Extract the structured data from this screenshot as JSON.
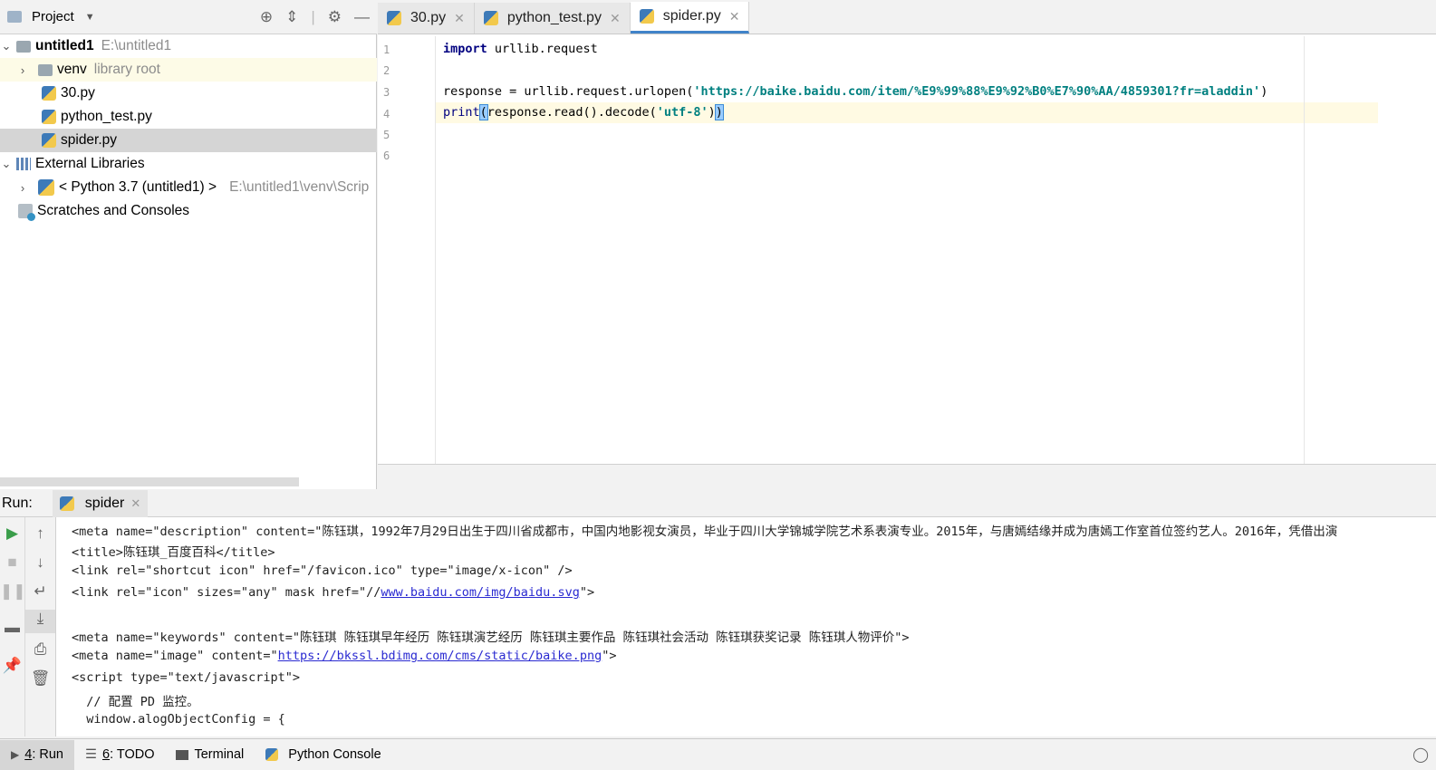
{
  "project_panel": {
    "title": "Project",
    "tree": [
      {
        "label": "untitled1",
        "path": "E:\\untitled1"
      },
      {
        "label": "venv",
        "note": "library root"
      },
      {
        "label": "30.py"
      },
      {
        "label": "python_test.py"
      },
      {
        "label": "spider.py"
      },
      {
        "label": "External Libraries"
      },
      {
        "label": "< Python 3.7 (untitled1) >",
        "path": "E:\\untitled1\\venv\\Scrip"
      },
      {
        "label": "Scratches and Consoles"
      }
    ]
  },
  "editor": {
    "tabs": [
      {
        "label": "30.py"
      },
      {
        "label": "python_test.py"
      },
      {
        "label": "spider.py"
      }
    ],
    "line_numbers": [
      "1",
      "2",
      "3",
      "4",
      "5",
      "6"
    ],
    "code": {
      "l1_kw": "import",
      "l1_rest": " urllib.request",
      "l3_a": "response = urllib.request.urlopen(",
      "l3_str": "'https://baike.baidu.com/item/%E9%99%88%E9%92%B0%E7%90%AA/4859301?fr=aladdin'",
      "l3_b": ")",
      "l4_a": "print",
      "l4_b": "(",
      "l4_c": "response.read().decode(",
      "l4_str": "'utf-8'",
      "l4_d": ")",
      "l4_e": ")"
    }
  },
  "run_panel": {
    "label": "Run:",
    "tab": "spider",
    "output": {
      "o1": "<meta name=\"description\" content=\"陈钰琪，1992年7月29日出生于四川省成都市，中国内地影视女演员，毕业于四川大学锦城学院艺术系表演专业。2015年，与唐嫣结缘并成为唐嫣工作室首位签约艺人。2016年，凭借出演",
      "o2": "<title>陈钰琪_百度百科</title>",
      "o3": "<link rel=\"shortcut icon\" href=\"/favicon.ico\" type=\"image/x-icon\" />",
      "o4_a": "<link rel=\"icon\" sizes=\"any\" mask href=\"//",
      "o4_link": "www.baidu.com/img/baidu.svg",
      "o4_b": "\">",
      "o5": "<meta name=\"keywords\" content=\"陈钰琪 陈钰琪早年经历 陈钰琪演艺经历 陈钰琪主要作品 陈钰琪社会活动 陈钰琪获奖记录 陈钰琪人物评价\">",
      "o6_a": "<meta name=\"image\" content=\"",
      "o6_link": "https://bkssl.bdimg.com/cms/static/baike.png",
      "o6_b": "\">",
      "o7": "<script type=\"text/javascript\">",
      "o8": "  // 配置 PD 监控。",
      "o9": "  window.alogObjectConfig = {"
    }
  },
  "status_bar": {
    "run_num": "4",
    "run_label": ": Run",
    "todo_num": "6",
    "todo_label": ": TODO",
    "terminal": "Terminal",
    "python_console": "Python Console"
  }
}
